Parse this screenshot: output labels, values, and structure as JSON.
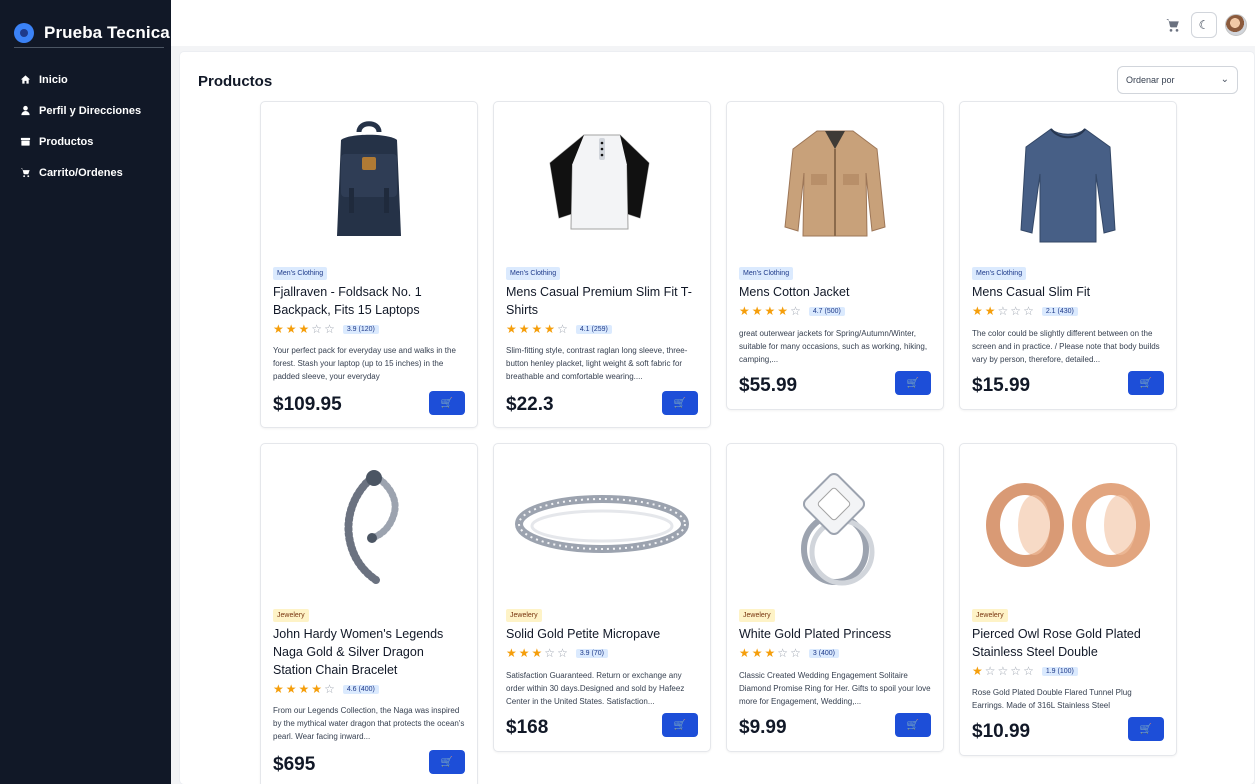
{
  "brand": {
    "title": "Prueba Tecnica"
  },
  "nav": [
    {
      "label": "Inicio",
      "icon": "home-icon"
    },
    {
      "label": "Perfil y Direcciones",
      "icon": "user-icon"
    },
    {
      "label": "Productos",
      "icon": "box-icon"
    },
    {
      "label": "Carrito/Ordenes",
      "icon": "cart-icon"
    }
  ],
  "header": {
    "cart_icon": "cart-icon",
    "theme_icon": "moon-icon"
  },
  "page": {
    "title": "Productos"
  },
  "sort": {
    "label": "Ordenar por",
    "icon": "chevron-down-icon"
  },
  "products": [
    {
      "category": "Men's Clothing",
      "title": "Fjallraven - Foldsack No. 1 Backpack, Fits 15 Laptops",
      "rating_value": 3.9,
      "rating_text": "3.9 (120)",
      "description": "Your perfect pack for everyday use and walks in the forest. Stash your laptop (up to 15 inches) in the padded sleeve, your everyday",
      "price": "$109.95"
    },
    {
      "category": "Men's Clothing",
      "title": "Mens Casual Premium Slim Fit T-Shirts",
      "rating_value": 4.1,
      "rating_text": "4.1 (259)",
      "description": "Slim-fitting style, contrast raglan long sleeve, three-button henley placket, light weight & soft fabric for breathable and comfortable wearing....",
      "price": "$22.3"
    },
    {
      "category": "Men's Clothing",
      "title": "Mens Cotton Jacket",
      "rating_value": 4.7,
      "rating_text": "4.7 (500)",
      "description": "great outerwear jackets for Spring/Autumn/Winter, suitable for many occasions, such as working, hiking, camping,...",
      "price": "$55.99"
    },
    {
      "category": "Men's Clothing",
      "title": "Mens Casual Slim Fit",
      "rating_value": 2.1,
      "rating_text": "2.1 (430)",
      "description": "The color could be slightly different between on the screen and in practice. / Please note that body builds vary by person, therefore, detailed...",
      "price": "$15.99"
    },
    {
      "category": "Jewelery",
      "title": "John Hardy Women's Legends Naga Gold & Silver Dragon Station Chain Bracelet",
      "rating_value": 4.6,
      "rating_text": "4.6 (400)",
      "description": "From our Legends Collection, the Naga was inspired by the mythical water dragon that protects the ocean's pearl. Wear facing inward...",
      "price": "$695"
    },
    {
      "category": "Jewelery",
      "title": "Solid Gold Petite Micropave",
      "rating_value": 3.9,
      "rating_text": "3.9 (70)",
      "description": "Satisfaction Guaranteed. Return or exchange any order within 30 days.Designed and sold by Hafeez Center in the United States. Satisfaction...",
      "price": "$168"
    },
    {
      "category": "Jewelery",
      "title": "White Gold Plated Princess",
      "rating_value": 3,
      "rating_text": "3 (400)",
      "description": "Classic Created Wedding Engagement Solitaire Diamond Promise Ring for Her. Gifts to spoil your love more for Engagement, Wedding,...",
      "price": "$9.99"
    },
    {
      "category": "Jewelery",
      "title": "Pierced Owl Rose Gold Plated Stainless Steel Double",
      "rating_value": 1.9,
      "rating_text": "1.9 (100)",
      "description": "Rose Gold Plated Double Flared Tunnel Plug Earrings. Made of 316L Stainless Steel",
      "price": "$10.99"
    }
  ],
  "colors": {
    "sidebar": "#111827",
    "accent": "#1d4ed8",
    "star": "#f59e0b",
    "mens_badge": "#dbeafe",
    "jewelery_badge": "#fef3c7"
  }
}
